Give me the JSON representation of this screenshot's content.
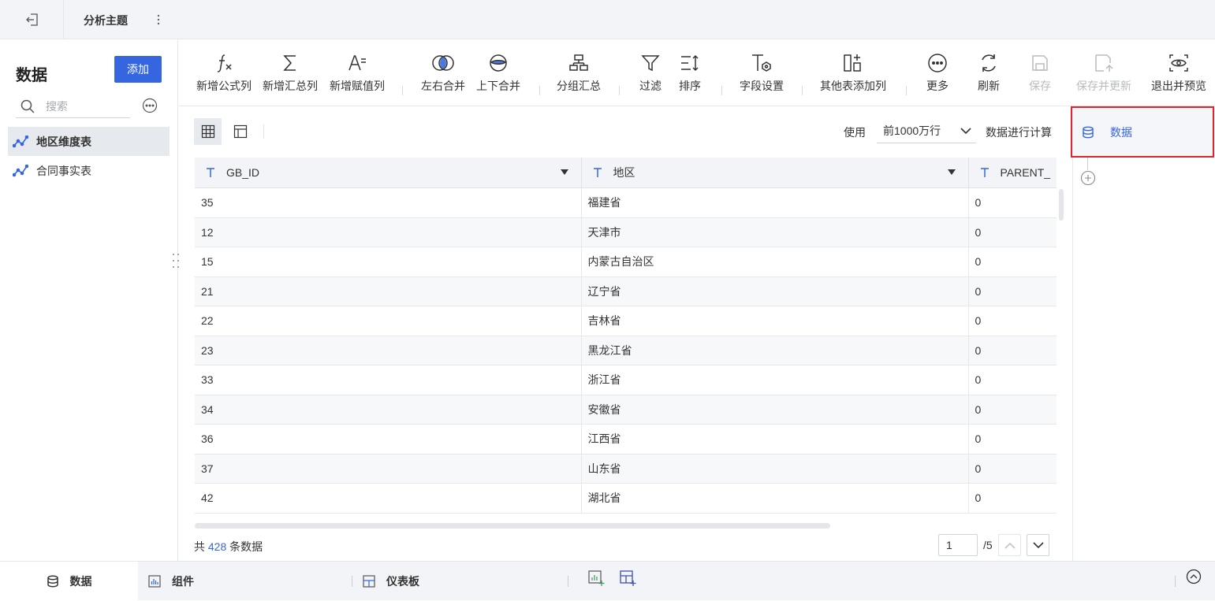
{
  "header": {
    "subject_title": "分析主题"
  },
  "left_panel": {
    "title": "数据",
    "add_label": "添加",
    "search_placeholder": "搜索",
    "tables": [
      {
        "label": "地区维度表",
        "active": true
      },
      {
        "label": "合同事实表",
        "active": false
      }
    ]
  },
  "toolbar": {
    "items": [
      {
        "label": "新增公式列",
        "icon": "formula-icon"
      },
      {
        "label": "新增汇总列",
        "icon": "sigma-icon"
      },
      {
        "label": "新增赋值列",
        "icon": "assign-icon"
      },
      {
        "label": "左右合并",
        "icon": "venn-icon"
      },
      {
        "label": "上下合并",
        "icon": "stack-merge-icon"
      },
      {
        "label": "分组汇总",
        "icon": "group-icon"
      },
      {
        "label": "过滤",
        "icon": "filter-icon"
      },
      {
        "label": "排序",
        "icon": "sort-icon"
      },
      {
        "label": "字段设置",
        "icon": "field-settings-icon"
      },
      {
        "label": "其他表添加列",
        "icon": "add-column-icon"
      },
      {
        "label": "更多",
        "icon": "more-icon"
      },
      {
        "label": "刷新",
        "icon": "refresh-icon"
      },
      {
        "label": "保存",
        "icon": "save-icon",
        "disabled": true
      },
      {
        "label": "保存并更新",
        "icon": "save-update-icon",
        "disabled": true
      },
      {
        "label": "退出并预览",
        "icon": "preview-icon"
      }
    ]
  },
  "data_view": {
    "limit_prefix": "使用",
    "limit_value": "前1000万行",
    "limit_suffix": "数据进行计算"
  },
  "table": {
    "columns": [
      {
        "name": "GB_ID",
        "type_icon": "text-type-icon"
      },
      {
        "name": "地区",
        "type_icon": "text-type-icon"
      },
      {
        "name": "PARENT_",
        "type_icon": "text-type-icon"
      }
    ],
    "rows": [
      [
        "35",
        "福建省",
        "0"
      ],
      [
        "12",
        "天津市",
        "0"
      ],
      [
        "15",
        "内蒙古自治区",
        "0"
      ],
      [
        "21",
        "辽宁省",
        "0"
      ],
      [
        "22",
        "吉林省",
        "0"
      ],
      [
        "23",
        "黑龙江省",
        "0"
      ],
      [
        "33",
        "浙江省",
        "0"
      ],
      [
        "34",
        "安徽省",
        "0"
      ],
      [
        "36",
        "江西省",
        "0"
      ],
      [
        "37",
        "山东省",
        "0"
      ],
      [
        "42",
        "湖北省",
        "0"
      ]
    ]
  },
  "footer": {
    "total_prefix": "共",
    "total_count": "428",
    "total_suffix": "条数据",
    "current_page": "1",
    "page_total": "/5"
  },
  "right_panel": {
    "node_label": "数据"
  },
  "bottom_tabs": {
    "data": "数据",
    "component": "组件",
    "dashboard": "仪表板"
  },
  "colors": {
    "accent": "#3566e0",
    "highlight_border": "#e0242a"
  }
}
